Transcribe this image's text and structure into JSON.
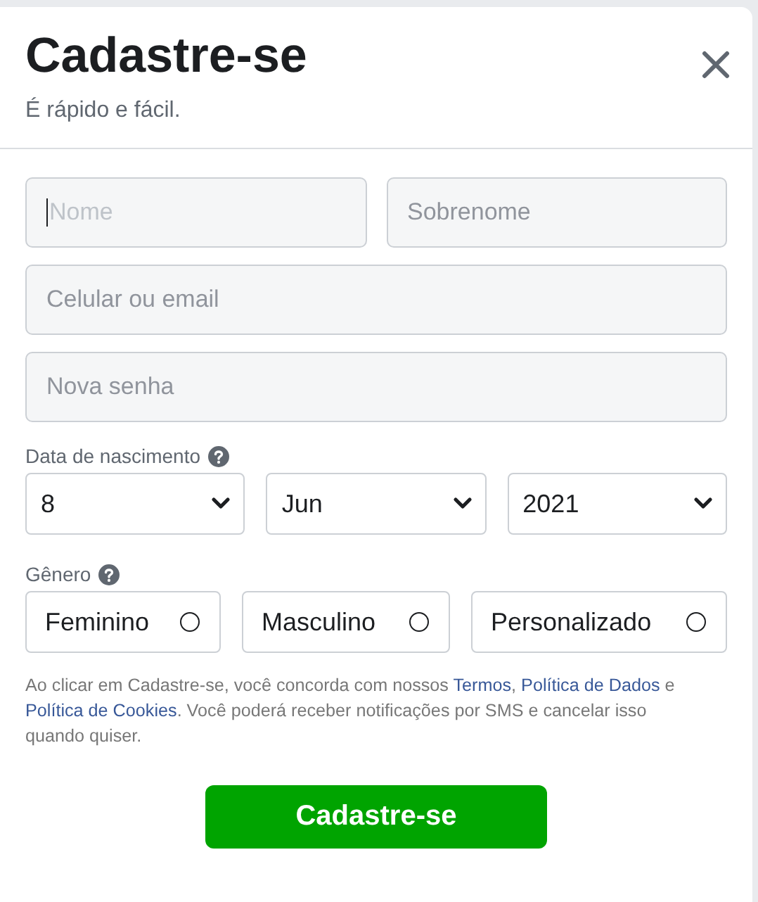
{
  "dialog": {
    "title": "Cadastre-se",
    "subtitle": "É rápido e fácil."
  },
  "name_fields": [
    {
      "placeholder": "Nome",
      "focused": true
    },
    {
      "placeholder": "Sobrenome",
      "focused": false
    }
  ],
  "fields": [
    {
      "placeholder": "Celular ou email",
      "focused": false
    },
    {
      "placeholder": "Nova senha",
      "focused": false
    }
  ],
  "birthday": {
    "label": "Data de nascimento",
    "selects": [
      {
        "value": "8"
      },
      {
        "value": "Jun"
      },
      {
        "value": "2021"
      }
    ]
  },
  "gender": {
    "label": "Gênero",
    "options": [
      {
        "label": "Feminino",
        "selected": false
      },
      {
        "label": "Masculino",
        "selected": false
      },
      {
        "label": "Personalizado",
        "selected": false
      }
    ]
  },
  "terms": [
    {
      "kind": "text",
      "text": "Ao clicar em Cadastre-se, você concorda com nossos "
    },
    {
      "kind": "link",
      "text": "Termos"
    },
    {
      "kind": "text",
      "text": ", "
    },
    {
      "kind": "link",
      "text": "Política de Dados"
    },
    {
      "kind": "text",
      "text": " e "
    },
    {
      "kind": "link",
      "text": "Política de Cookies"
    },
    {
      "kind": "text",
      "text": ". Você poderá receber notificações por SMS e cancelar isso quando quiser."
    }
  ],
  "submit": "Cadastre-se"
}
